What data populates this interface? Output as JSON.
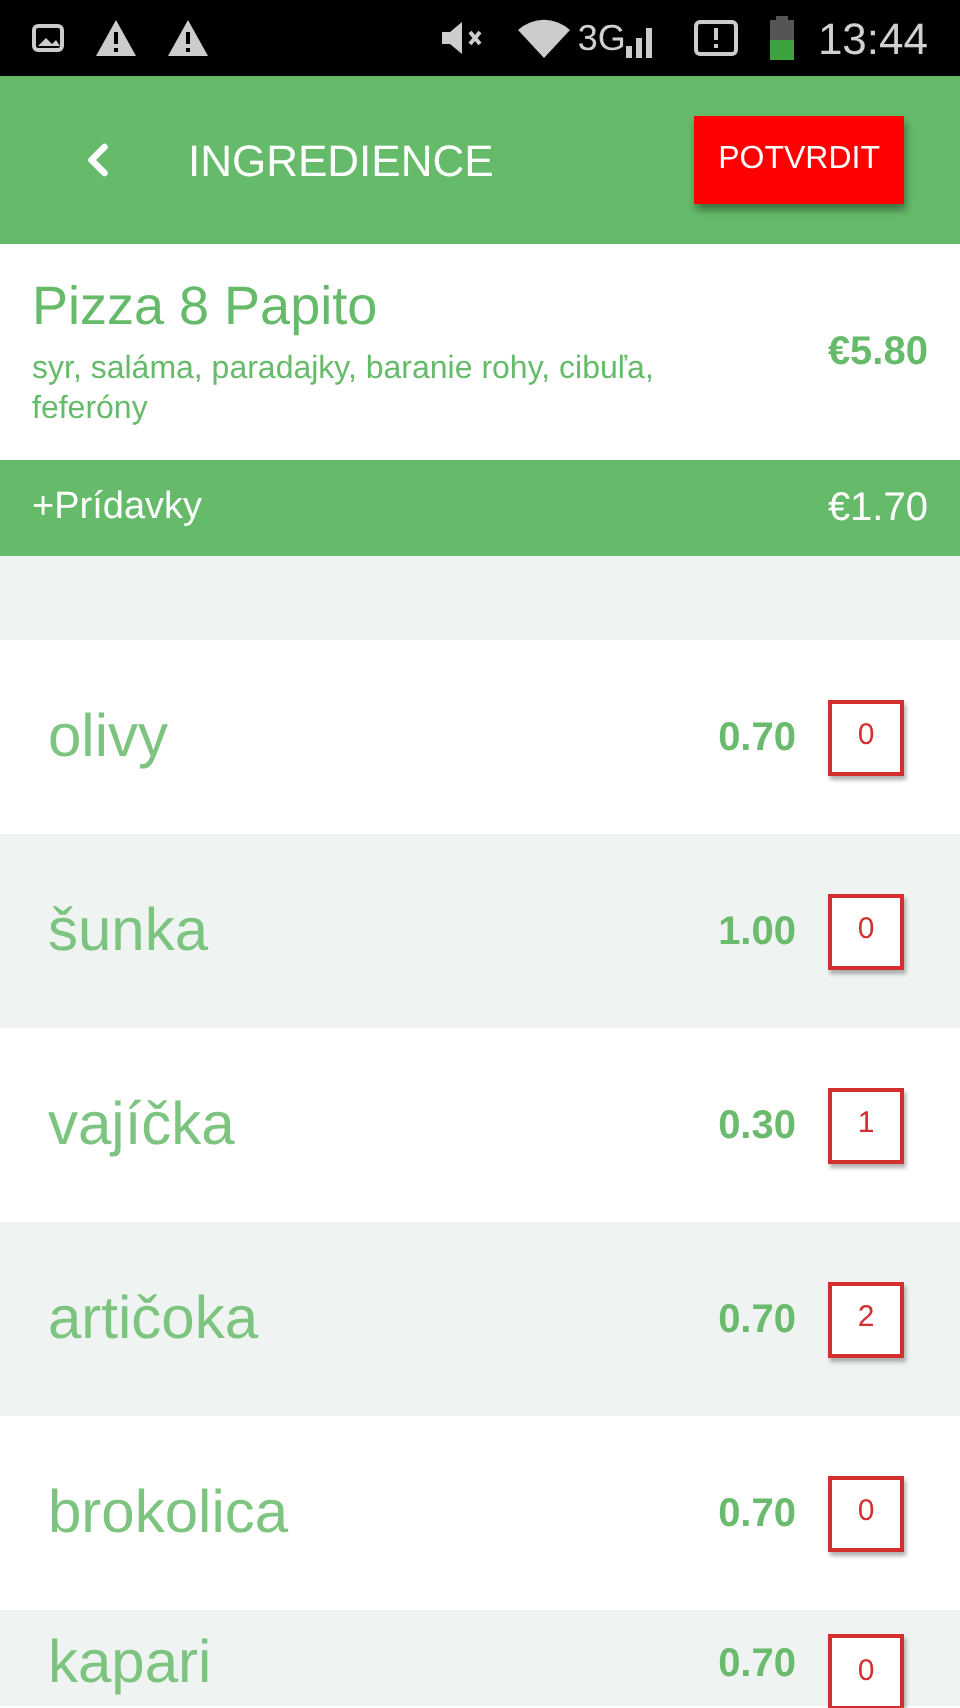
{
  "status_bar": {
    "network": "3G",
    "time": "13:44"
  },
  "header": {
    "title": "INGREDIENCE",
    "confirm": "POTVRDIT"
  },
  "product": {
    "name": "Pizza 8 Papito",
    "ingredients": "syr, saláma, paradajky, baranie rohy, cibuľa, feferóny",
    "price": "€5.80"
  },
  "extras_bar": {
    "label": "+Prídavky",
    "total": "€1.70"
  },
  "items": [
    {
      "name": "olivy",
      "price": "0.70",
      "count": "0"
    },
    {
      "name": "šunka",
      "price": "1.00",
      "count": "0"
    },
    {
      "name": "vajíčka",
      "price": "0.30",
      "count": "1"
    },
    {
      "name": "artičoka",
      "price": "0.70",
      "count": "2"
    },
    {
      "name": "brokolica",
      "price": "0.70",
      "count": "0"
    },
    {
      "name": "kapari",
      "price": "0.70",
      "count": "0"
    }
  ]
}
